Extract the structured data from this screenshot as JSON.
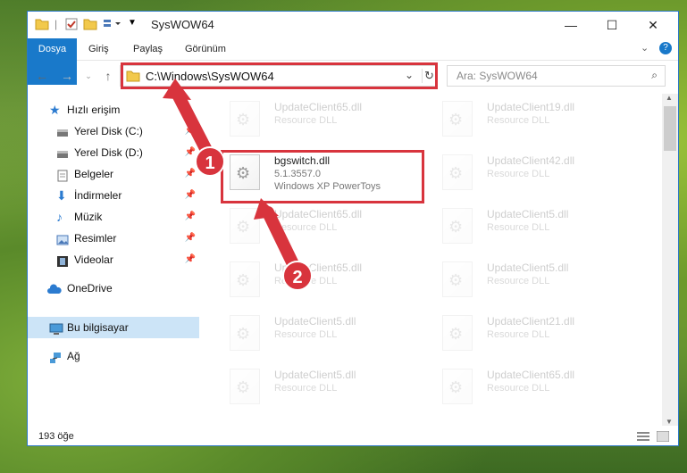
{
  "window": {
    "title": "SysWOW64",
    "controls": {
      "minimize": "—",
      "maximize": "☐",
      "close": "✕"
    }
  },
  "ribbon": {
    "tabs": [
      "Dosya",
      "Giriş",
      "Paylaş",
      "Görünüm"
    ],
    "help": "?"
  },
  "nav": {
    "address": "C:\\Windows\\SysWOW64",
    "search_placeholder": "Ara: SysWOW64"
  },
  "sidebar": {
    "items": [
      {
        "label": "Hızlı erişim",
        "icon": "star-icon"
      },
      {
        "label": "Yerel Disk (C:)",
        "icon": "drive-icon"
      },
      {
        "label": "Yerel Disk (D:)",
        "icon": "drive-icon"
      },
      {
        "label": "Belgeler",
        "icon": "document-icon"
      },
      {
        "label": "İndirmeler",
        "icon": "download-icon"
      },
      {
        "label": "Müzik",
        "icon": "music-icon"
      },
      {
        "label": "Resimler",
        "icon": "picture-icon"
      },
      {
        "label": "Videolar",
        "icon": "video-icon"
      },
      {
        "label": "OneDrive",
        "icon": "cloud-icon"
      },
      {
        "label": "Bu bilgisayar",
        "icon": "computer-icon"
      },
      {
        "label": "Ağ",
        "icon": "network-icon"
      }
    ]
  },
  "files": {
    "left": [
      {
        "name": "UpdateClient65.dll",
        "sub": "Resource DLL"
      },
      {
        "name": "bgswitch.dll",
        "sub1": "5.1.3557.0",
        "sub2": "Windows XP PowerToys"
      },
      {
        "name": "UpdateClient65.dll",
        "sub": "Resource DLL"
      },
      {
        "name": "UpdateClient65.dll",
        "sub": "Resource DLL"
      },
      {
        "name": "UpdateClient5.dll",
        "sub": "Resource DLL"
      },
      {
        "name": "UpdateClient5.dll",
        "sub": "Resource DLL"
      }
    ],
    "right": [
      {
        "name": "UpdateClient19.dll",
        "sub": "Resource DLL"
      },
      {
        "name": "UpdateClient42.dll",
        "sub": "Resource DLL"
      },
      {
        "name": "UpdateClient5.dll",
        "sub": "Resource DLL"
      },
      {
        "name": "UpdateClient5.dll",
        "sub": "Resource DLL"
      },
      {
        "name": "UpdateClient21.dll",
        "sub": "Resource DLL"
      },
      {
        "name": "UpdateClient65.dll",
        "sub": "Resource DLL"
      }
    ]
  },
  "status": {
    "count": "193 öğe"
  },
  "callouts": [
    "1",
    "2"
  ],
  "colors": {
    "accent": "#1979ca",
    "highlight": "#d8343d",
    "selected": "#cce4f7"
  }
}
